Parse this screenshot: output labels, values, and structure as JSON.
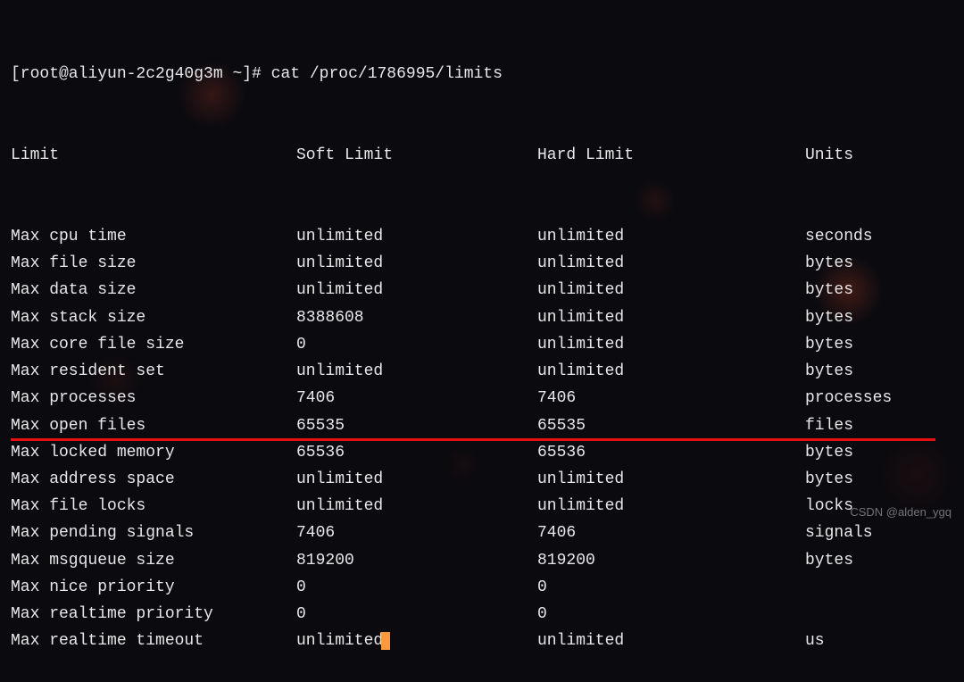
{
  "prompt": {
    "user_host": "[root@aliyun-2c2g40g3m ~]#",
    "command": "cat /proc/1786995/limits"
  },
  "headers": {
    "limit": "Limit",
    "soft": "Soft Limit",
    "hard": "Hard Limit",
    "units": "Units"
  },
  "rows": [
    {
      "limit": "Max cpu time",
      "soft": "unlimited",
      "hard": "unlimited",
      "units": "seconds"
    },
    {
      "limit": "Max file size",
      "soft": "unlimited",
      "hard": "unlimited",
      "units": "bytes"
    },
    {
      "limit": "Max data size",
      "soft": "unlimited",
      "hard": "unlimited",
      "units": "bytes"
    },
    {
      "limit": "Max stack size",
      "soft": "8388608",
      "hard": "unlimited",
      "units": "bytes"
    },
    {
      "limit": "Max core file size",
      "soft": "0",
      "hard": "unlimited",
      "units": "bytes"
    },
    {
      "limit": "Max resident set",
      "soft": "unlimited",
      "hard": "unlimited",
      "units": "bytes"
    },
    {
      "limit": "Max processes",
      "soft": "7406",
      "hard": "7406",
      "units": "processes"
    },
    {
      "limit": "Max open files",
      "soft": "65535",
      "hard": "65535",
      "units": "files",
      "hl": true
    },
    {
      "limit": "Max locked memory",
      "soft": "65536",
      "hard": "65536",
      "units": "bytes"
    },
    {
      "limit": "Max address space",
      "soft": "unlimited",
      "hard": "unlimited",
      "units": "bytes"
    },
    {
      "limit": "Max file locks",
      "soft": "unlimited",
      "hard": "unlimited",
      "units": "locks"
    },
    {
      "limit": "Max pending signals",
      "soft": "7406",
      "hard": "7406",
      "units": "signals"
    },
    {
      "limit": "Max msgqueue size",
      "soft": "819200",
      "hard": "819200",
      "units": "bytes"
    },
    {
      "limit": "Max nice priority",
      "soft": "0",
      "hard": "0",
      "units": ""
    },
    {
      "limit": "Max realtime priority",
      "soft": "0",
      "hard": "0",
      "units": ""
    },
    {
      "limit": "Max realtime timeout",
      "soft": "unlimited",
      "hard": "unlimited",
      "units": "us"
    }
  ],
  "last_row_has_cursor_after_soft": true,
  "watermark": "CSDN @alden_ygq"
}
